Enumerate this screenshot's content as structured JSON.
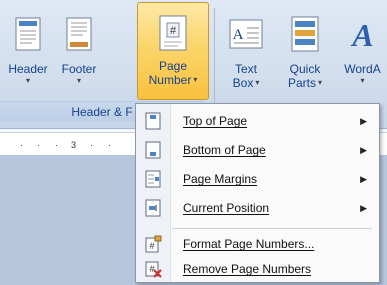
{
  "ribbon": {
    "buttons": [
      {
        "label": "Header",
        "caret": "▾"
      },
      {
        "label": "Footer",
        "caret": "▾"
      },
      {
        "label": "Page",
        "label2": "Number",
        "caret": "▾"
      },
      {
        "label": "Text",
        "label2": "Box",
        "caret": "▾"
      },
      {
        "label": "Quick",
        "label2": "Parts",
        "caret": "▾"
      },
      {
        "label": "WordA",
        "caret": "▾"
      }
    ],
    "group_label": "Header & F"
  },
  "ruler": {
    "marks": [
      "·",
      "·",
      "·",
      "3",
      "·",
      "·"
    ]
  },
  "menu": {
    "items": [
      {
        "label": "Top of Page",
        "arrow": "▶"
      },
      {
        "label": "Bottom of Page",
        "arrow": "▶"
      },
      {
        "label": "Page Margins",
        "arrow": "▶"
      },
      {
        "label": "Current Position",
        "arrow": "▶"
      },
      {
        "label": "Format Page Numbers..."
      },
      {
        "label": "Remove Page Numbers"
      }
    ]
  },
  "colors": {
    "accent": "#15428b",
    "active_button": "#fbd56b"
  }
}
